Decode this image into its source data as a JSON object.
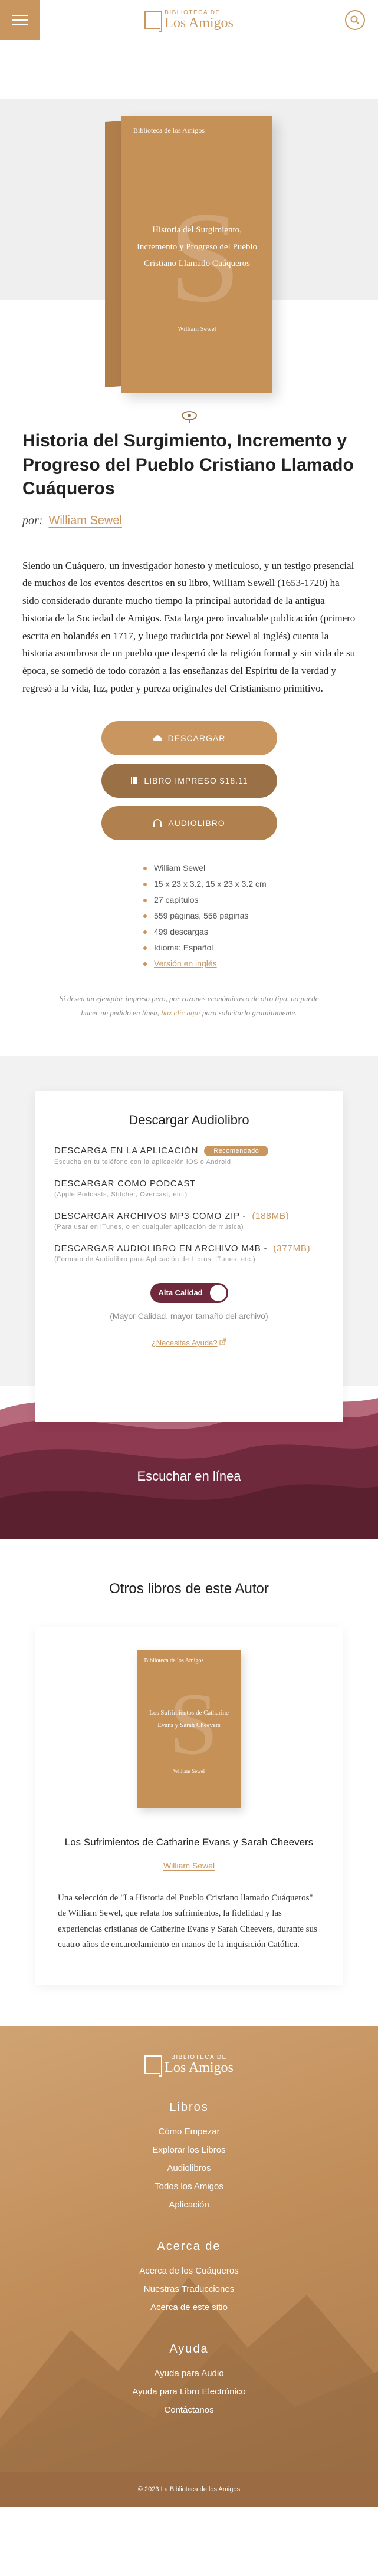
{
  "header": {
    "logo_top": "BIBLIOTECA DE",
    "logo_bottom": "Los Amigos",
    "logo_mark": "[:]",
    "menu_icon": "hamburger-icon",
    "search_icon": "search-icon"
  },
  "book": {
    "cover_logo": "Biblioteca de los Amigos",
    "cover_title": "Historia del Surgimiento, Incremento y Progreso del Pueblo Cristiano Llamado Cuáqueros",
    "cover_author": "William Sewel",
    "cover_letter": "S",
    "zoom_icon": "magnify-icon",
    "title": "Historia del Surgimiento, Incremento y Progreso del Pueblo Cristiano Llamado Cuáqueros",
    "by_prefix": "por:",
    "author": "William Sewel",
    "summary": "Siendo un Cuáquero, un investigador honesto y meticuloso, y un testigo presencial de muchos de los eventos descritos en su libro, William Sewell (1653-1720) ha sido considerado durante mucho tiempo la principal autoridad de la antigua historia de la Sociedad de Amigos. Esta larga pero invaluable publicación (primero escrita en holandés en 1717, y luego traducida por Sewel al inglés) cuenta la historia asombrosa de un pueblo que despertó de la religión formal y sin vida de su época, se sometió de todo corazón a las enseñanzas del Espíritu de la verdad y regresó a la vida, luz, poder y pureza originales del Cristianismo primitivo."
  },
  "buttons": {
    "download": "DESCARGAR",
    "print": "LIBRO IMPRESO $18.11",
    "audio": "AUDIOLIBRO"
  },
  "meta": [
    "William Sewel",
    "15 x 23 x 3.2, 15 x 23 x 3.2 cm",
    "27 capítulos",
    "559 páginas, 556 páginas",
    "499 descargas",
    "Idioma: Español",
    "Versión en inglés"
  ],
  "notice": {
    "before": "Si desea un ejemplar impreso pero, por razones económicas o de otro tipo, no puede hacer un pedido en línea,",
    "link": "haz clic aquí",
    "after": "para solicitarlo gratuitamente."
  },
  "audio": {
    "heading": "Descargar Audiolibro",
    "items": [
      {
        "label": "DESCARGA EN LA APLICACIÓN",
        "badge": "Recomendado",
        "size": "",
        "sub": "Escucha en tu teléfono con la aplicación iOS o Android"
      },
      {
        "label": "DESCARGAR COMO PODCAST",
        "badge": "",
        "size": "",
        "sub": "(Apple Podcasts, Stitcher, Overcast, etc.)"
      },
      {
        "label": "DESCARGAR ARCHIVOS MP3 COMO ZIP -",
        "badge": "",
        "size": "(188MB)",
        "sub": "(Para usar en iTunes, o en cualquier aplicación de música)"
      },
      {
        "label": "DESCARGAR AUDIOLIBRO EN ARCHIVO M4B -",
        "badge": "",
        "size": "(377MB)",
        "sub": "(Formato de Audiolibro para Aplicación de Libros, iTunes, etc.)"
      }
    ],
    "quality_label": "Alta Calidad",
    "quality_note": "(Mayor Calidad, mayor tamaño del archivo)",
    "help": "¿Necesitas Ayuda?",
    "listen_online": "Escuchar en línea"
  },
  "other": {
    "heading": "Otros libros de este Autor",
    "cover_logo": "Biblioteca de los Amigos",
    "cover_title": "Los Sufrimientos de Catharine Evans y Sarah Cheevers",
    "cover_author": "William Sewel",
    "title": "Los Sufrimientos de Catharine Evans y Sarah Cheevers",
    "author": "William Sewel",
    "desc": "Una selección de \"La Historia del Pueblo Cristiano llamado Cuáqueros\" de William Sewel, que relata los sufrimientos, la fidelidad y las experiencias cristianas de Catherine Evans y Sarah Cheevers, durante sus cuatro años de encarcelamiento en manos de la inquisición Católica."
  },
  "footer": {
    "logo_top": "BIBLIOTECA DE",
    "logo_bottom": "Los Amigos",
    "col1_title": "Libros",
    "col1": [
      "Cómo Empezar",
      "Explorar los Libros",
      "Audiolibros",
      "Todos los Amigos",
      "Aplicación"
    ],
    "col2_title": "Acerca de",
    "col2": [
      "Acerca de los Cuáqueros",
      "Nuestras Traducciones",
      "Acerca de este sitio"
    ],
    "col3_title": "Ayuda",
    "col3": [
      "Ayuda para Audio",
      "Ayuda para Libro Electrónico",
      "Contáctanos"
    ],
    "copyright": "© 2023 La Biblioteca de los Amigos"
  },
  "colors": {
    "accent": "#c9965f",
    "dark_accent": "#9a7046",
    "maroon": "#6e2a3c"
  }
}
